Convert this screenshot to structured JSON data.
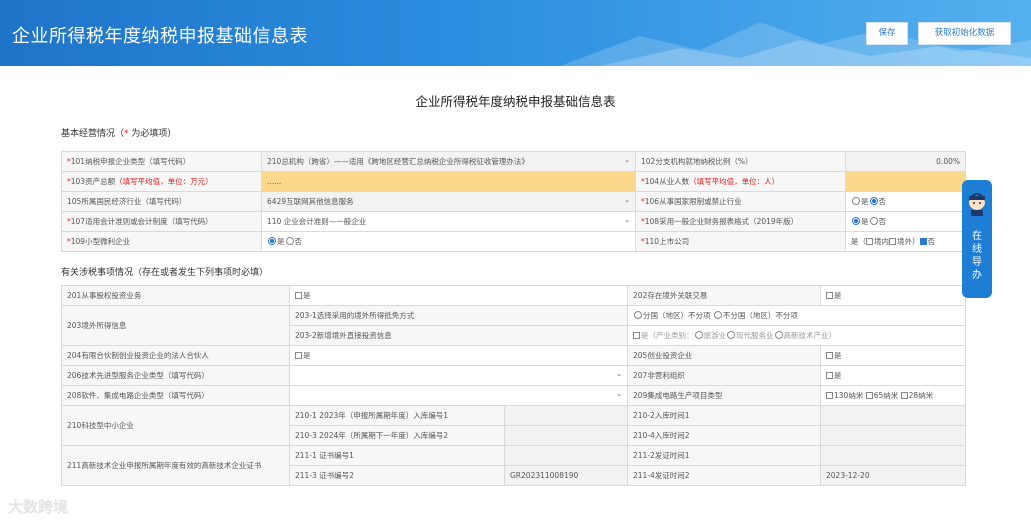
{
  "header": {
    "title": "企业所得税年度纳税申报基础信息表",
    "save_label": "保存",
    "fetch_label": "获取初始化数据"
  },
  "page": {
    "heading": "企业所得税年度纳税申报基础信息表"
  },
  "section1": {
    "title_prefix": "基本经营情况（",
    "required_mark": "*",
    "title_suffix": " 为必填项）"
  },
  "r101": {
    "label": "101纳税申报企业类型（填写代码）",
    "value": "210总机构（跨省）——适用《跨地区经营汇总纳税企业所得税征收管理办法》",
    "label2": "102分支机构就地纳税比例（%）",
    "value2": "0.00%"
  },
  "r103": {
    "label": "103资产总额",
    "hint": "（填写平均值，单位：万元）",
    "value": "......",
    "label2": "104从业人数",
    "hint2": "（填写平均值，单位：人）"
  },
  "r105": {
    "label": "105所属国民经济行业（填写代码）",
    "value": "6429互联网其他信息服务",
    "label2": "106从事国家限制或禁止行业",
    "opt_yes": "是",
    "opt_no": "否"
  },
  "r107": {
    "label": "107适用会计准则或会计制度（填写代码）",
    "value": "110 企业会计准则—一般企业",
    "label2": "108采用一般企业财务报表格式（2019年版）",
    "opt_yes": "是",
    "opt_no": "否"
  },
  "r109": {
    "label": "109小型微利企业",
    "opt_yes": "是",
    "opt_no": "否",
    "label2": "110上市公司",
    "opt_a": "是（",
    "opt_b": "境内",
    "opt_c": "境外）",
    "opt_d": "否"
  },
  "section2": {
    "title": "有关涉税事项情况（存在或者发生下列事项时必填）"
  },
  "r201": {
    "label": "201从事股权投资业务",
    "opt": "是",
    "label2": "202存在境外关联交易",
    "opt2": "是"
  },
  "r203": {
    "label": "203境外所得信息",
    "sub1": "203-1选择采用的境外所得抵免方式",
    "sub1_a": "分国（地区）不分项",
    "sub1_b": "不分国（地区）不分项",
    "sub2": "203-2新增境外直接投资信息",
    "sub2_a": "是（产业类别：",
    "sub2_b": "旅游业",
    "sub2_c": "现代服务业",
    "sub2_d": "高新技术产业）"
  },
  "r204": {
    "label": "204有限合伙制创业投资企业的法人合伙人",
    "opt": "是",
    "label2": "205创业投资企业",
    "opt2": "是"
  },
  "r206": {
    "label": "206技术先进型服务企业类型（填写代码）",
    "label2": "207非营利组织",
    "opt2": "是"
  },
  "r208": {
    "label": "208软件、集成电路企业类型（填写代码）",
    "label2": "209集成电路生产项目类型",
    "opt_a": "130纳米",
    "opt_b": "65纳米",
    "opt_c": "28纳米"
  },
  "r210": {
    "label": "210科技型中小企业",
    "a": "210-1 2023年（申报所属期年度）入库编号1",
    "b": "210-2入库时间1",
    "c": "210-3 2024年（所属期下一年度）入库编号2",
    "d": "210-4入库时间2"
  },
  "r211": {
    "label": "211高新技术企业申报所属期年度有效的高新技术企业证书",
    "a": "211-1 证书编号1",
    "b": "211-2发证时间1",
    "c": "211-3 证书编号2",
    "c_val": "GR202311008190",
    "d": "211-4发证时间2",
    "d_val": "2023-12-20"
  },
  "side": {
    "text": "在线导办"
  },
  "watermark": {
    "text": "大数跨境"
  },
  "colors": {
    "brand_blue": "#1f74c8",
    "highlight_yellow": "#fbd88c",
    "required_red": "#e02020"
  }
}
